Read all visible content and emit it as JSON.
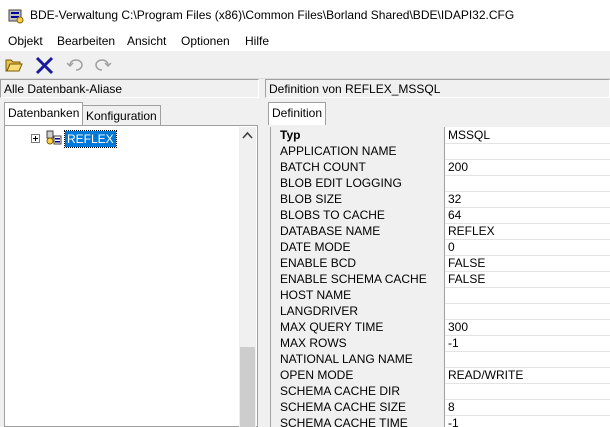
{
  "window": {
    "title": "BDE-Verwaltung  C:\\Program Files (x86)\\Common Files\\Borland Shared\\BDE\\IDAPI32.CFG"
  },
  "menu": [
    {
      "label": "Objekt"
    },
    {
      "label": "Bearbeiten"
    },
    {
      "label": "Ansicht"
    },
    {
      "label": "Optionen"
    },
    {
      "label": "Hilfe"
    }
  ],
  "toolbar": [
    "open-folder-icon",
    "delete-x-icon",
    "undo-icon",
    "redo-icon"
  ],
  "left_panel": {
    "caption": "Alle Datenbank-Aliase",
    "tabs": [
      {
        "label": "Datenbanken"
      },
      {
        "label": "Konfiguration"
      }
    ],
    "tree": {
      "selected_label": "REFLEX"
    }
  },
  "right_panel": {
    "caption": "Definition von REFLEX_MSSQL",
    "tabs": [
      {
        "label": "Definition"
      }
    ],
    "rows": [
      {
        "name": "Typ",
        "value": "MSSQL"
      },
      {
        "name": "APPLICATION NAME",
        "value": ""
      },
      {
        "name": "BATCH COUNT",
        "value": "200"
      },
      {
        "name": "BLOB EDIT LOGGING",
        "value": ""
      },
      {
        "name": "BLOB SIZE",
        "value": "32"
      },
      {
        "name": "BLOBS TO CACHE",
        "value": "64"
      },
      {
        "name": "DATABASE NAME",
        "value": "REFLEX"
      },
      {
        "name": "DATE MODE",
        "value": "0"
      },
      {
        "name": "ENABLE BCD",
        "value": "FALSE"
      },
      {
        "name": "ENABLE SCHEMA CACHE",
        "value": "FALSE"
      },
      {
        "name": "HOST NAME",
        "value": ""
      },
      {
        "name": "LANGDRIVER",
        "value": ""
      },
      {
        "name": "MAX QUERY TIME",
        "value": "300"
      },
      {
        "name": "MAX ROWS",
        "value": "-1"
      },
      {
        "name": "NATIONAL LANG NAME",
        "value": ""
      },
      {
        "name": "OPEN MODE",
        "value": "READ/WRITE"
      },
      {
        "name": "SCHEMA CACHE DIR",
        "value": ""
      },
      {
        "name": "SCHEMA CACHE SIZE",
        "value": "8"
      },
      {
        "name": "SCHEMA CACHE TIME",
        "value": "-1"
      }
    ]
  },
  "colors": {
    "selection": "#0078d7",
    "panel_bg": "#f0f0f0"
  }
}
